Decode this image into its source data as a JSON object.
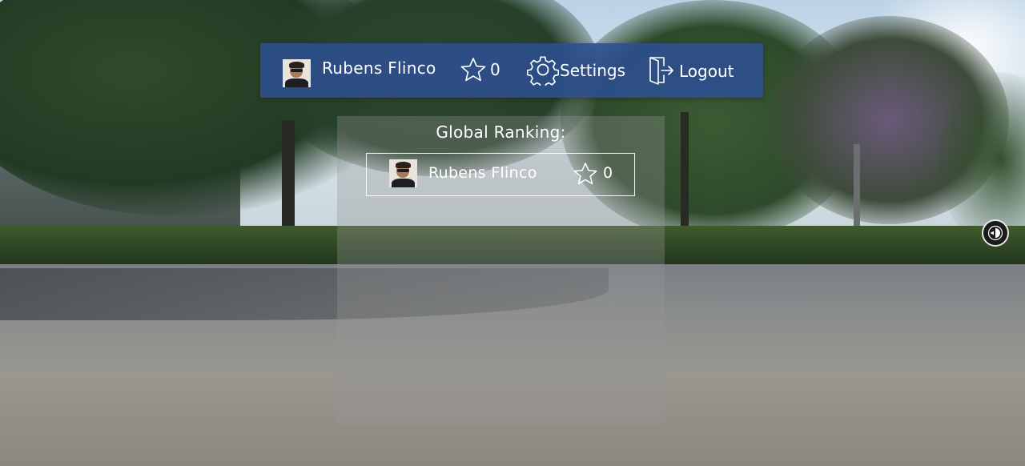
{
  "user": {
    "name": "Rubens  Flinco",
    "score": "0"
  },
  "topbar": {
    "settings_label": "Settings",
    "logout_label": "Logout",
    "icons": {
      "star": "star-icon",
      "settings": "gear-icon",
      "logout": "logout-door-icon"
    }
  },
  "ranking": {
    "title": "Global  Ranking:",
    "entries": [
      {
        "name": "Rubens  Flinco",
        "score": "0"
      }
    ]
  },
  "viewer": {
    "orientation_icon": "compass-orientation-icon"
  },
  "colors": {
    "topbar_bg": "#2d4e91",
    "text": "#ffffff",
    "panel_bg": "rgba(150,150,150,0.34)"
  }
}
